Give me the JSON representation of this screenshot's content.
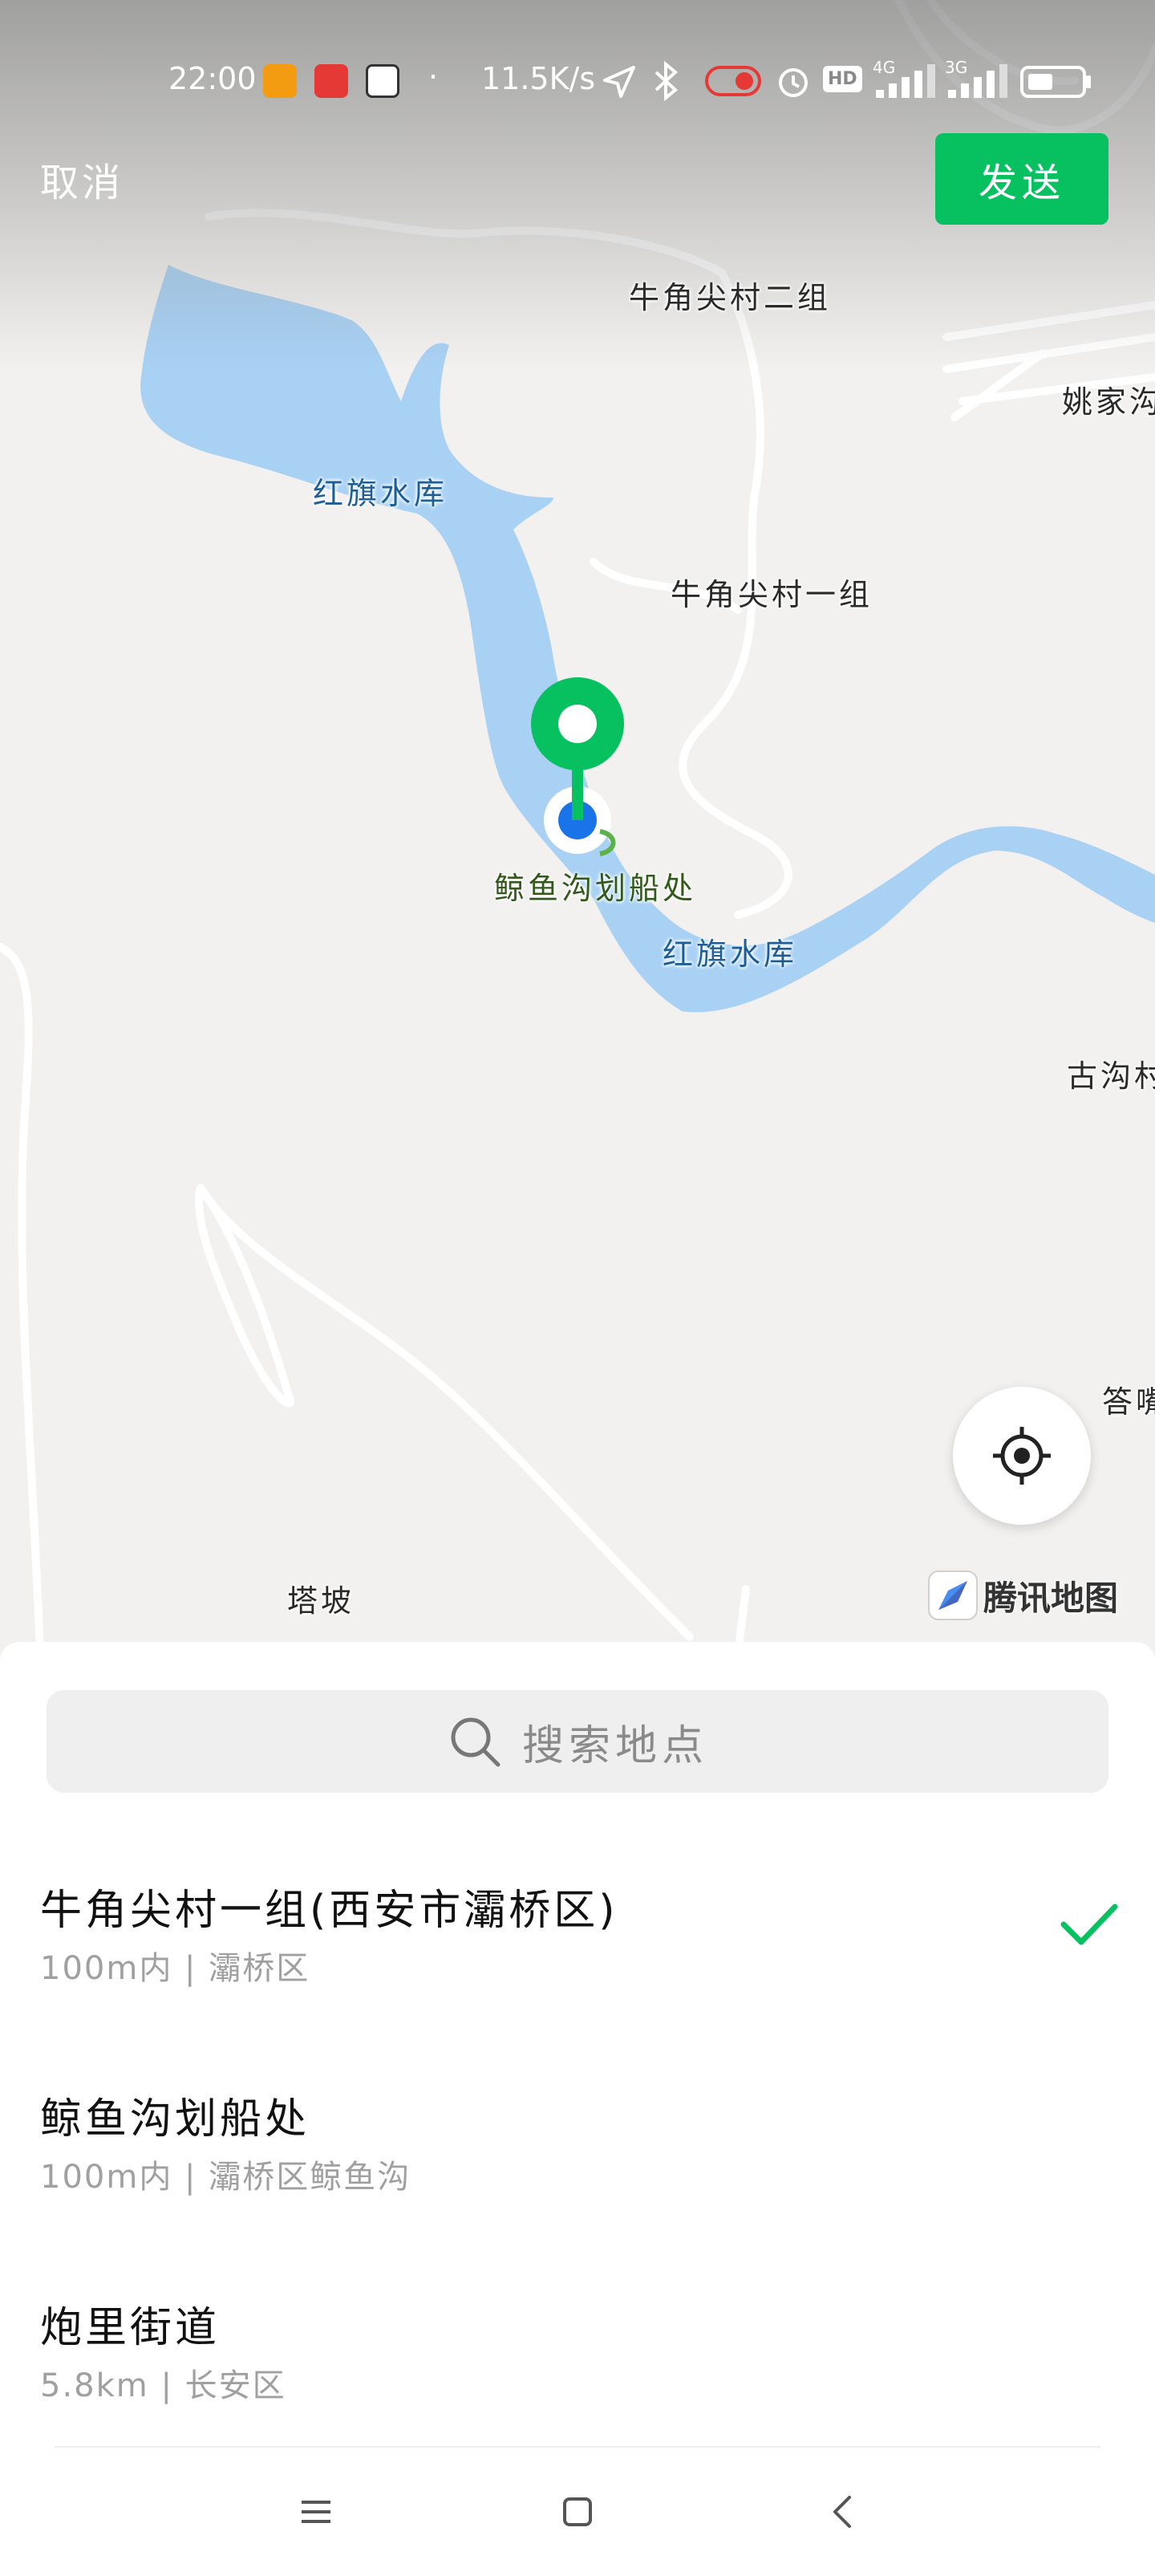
{
  "status_bar": {
    "time": "22:00",
    "net_speed": "11.5K/s",
    "icons": [
      "app-notification-icon",
      "app-notification-icon",
      "app-notification-icon",
      "location-arrow-icon",
      "bluetooth-icon",
      "toggle-icon",
      "alarm-icon",
      "hd-icon",
      "signal-4g-icon",
      "signal-3g-icon",
      "battery-icon"
    ],
    "signal_1": "4G",
    "signal_2": "3G",
    "hd": "HD"
  },
  "header": {
    "cancel_label": "取消",
    "send_label": "发送"
  },
  "map": {
    "labels": {
      "village_2": "牛角尖村二组",
      "yao_jia": "姚家沟",
      "reservoir_top": "红旗水库",
      "village_1": "牛角尖村一组",
      "poi": "鲸鱼沟划船处",
      "reservoir_bottom": "红旗水库",
      "gugou": "古沟村",
      "dazui": "答嘴",
      "tapo": "塔坡"
    },
    "brand": "腾讯地图",
    "colors": {
      "water": "#a8d1f4",
      "land": "#f2f1ef",
      "road": "#ffffff",
      "pin": "#07c160",
      "location_dot": "#1a73e8"
    }
  },
  "search": {
    "placeholder": "搜索地点"
  },
  "results": [
    {
      "title": "牛角尖村一组(西安市灞桥区)",
      "distance": "100m内",
      "area": "灞桥区",
      "selected": true
    },
    {
      "title": "鲸鱼沟划船处",
      "distance": "100m内",
      "area": "灞桥区鲸鱼沟",
      "selected": false
    },
    {
      "title": "炮里街道",
      "distance": "5.8km",
      "area": "长安区",
      "selected": false
    }
  ],
  "accent_color": "#07c160"
}
